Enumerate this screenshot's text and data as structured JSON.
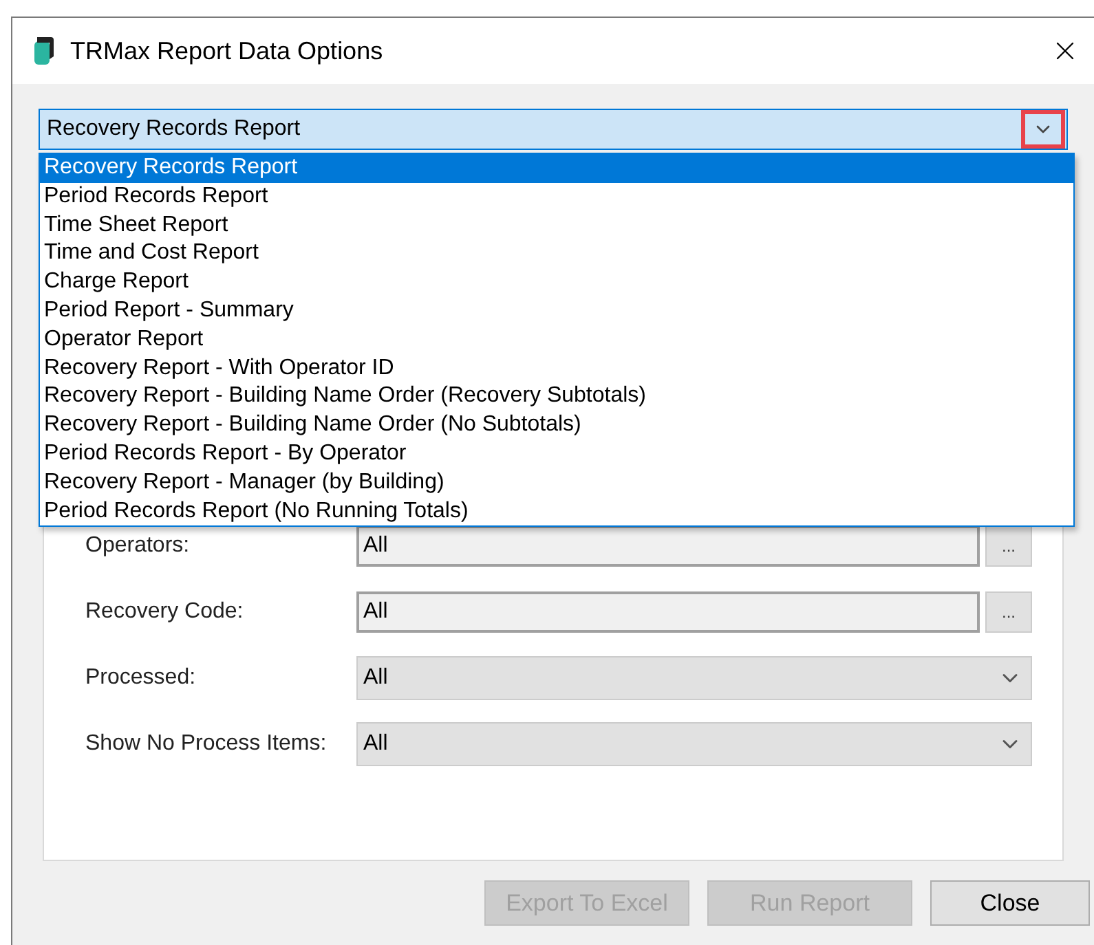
{
  "window": {
    "title": "TRMax Report Data Options"
  },
  "report_select": {
    "value": "Recovery Records Report",
    "expanded": true,
    "options": [
      {
        "label": "Recovery Records Report",
        "selected": true
      },
      {
        "label": "Period Records Report",
        "selected": false
      },
      {
        "label": "Time Sheet Report",
        "selected": false
      },
      {
        "label": "Time and Cost Report",
        "selected": false
      },
      {
        "label": "Charge Report",
        "selected": false
      },
      {
        "label": "Period Report - Summary",
        "selected": false
      },
      {
        "label": "Operator Report",
        "selected": false
      },
      {
        "label": "Recovery Report - With Operator ID",
        "selected": false
      },
      {
        "label": "Recovery Report - Building Name Order (Recovery Subtotals)",
        "selected": false
      },
      {
        "label": "Recovery Report - Building Name Order (No Subtotals)",
        "selected": false
      },
      {
        "label": "Period Records Report - By Operator",
        "selected": false
      },
      {
        "label": "Recovery Report - Manager (by Building)",
        "selected": false
      },
      {
        "label": "Period Records Report (No Running Totals)",
        "selected": false
      }
    ]
  },
  "fields": [
    {
      "kind": "browse",
      "label": "Operators:",
      "value": "All",
      "button": "..."
    },
    {
      "kind": "browse",
      "label": "Recovery Code:",
      "value": "All",
      "button": "..."
    },
    {
      "kind": "select",
      "label": "Processed:",
      "value": "All"
    },
    {
      "kind": "select",
      "label": "Show No Process Items:",
      "value": "All"
    }
  ],
  "buttons": [
    {
      "label": "Export To Excel",
      "disabled": true
    },
    {
      "label": "Run Report",
      "disabled": true
    },
    {
      "label": "Close",
      "disabled": false
    }
  ]
}
